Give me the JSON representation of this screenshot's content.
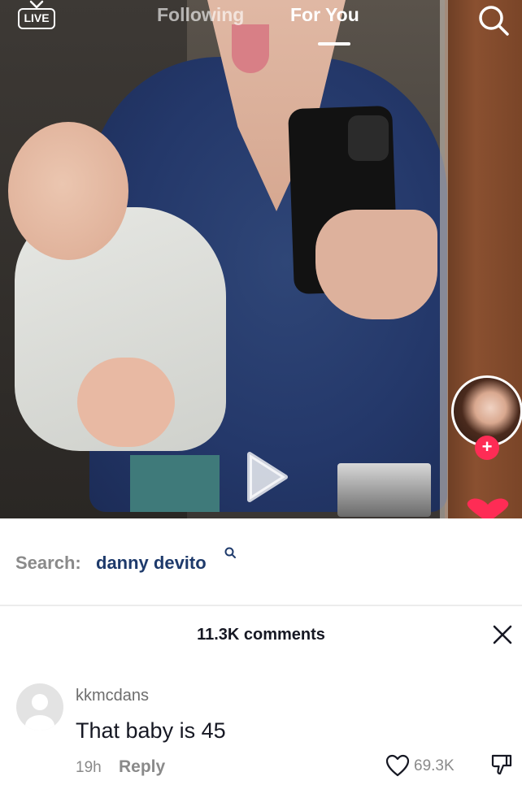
{
  "top_nav": {
    "live_label": "LIVE",
    "tab_following": "Following",
    "tab_for_you": "For You",
    "icons": [
      "live-icon",
      "search-icon"
    ]
  },
  "video": {
    "playing": false,
    "icons": [
      "play-icon",
      "plus-icon"
    ]
  },
  "search_suggestion": {
    "prefix": "Search:",
    "term": "danny devito",
    "icon": "search-icon"
  },
  "comments": {
    "count_label": "11.3K comments",
    "close_icon": "close-icon",
    "items": [
      {
        "username": "kkmcdans",
        "text": "That baby is 45",
        "time": "19h",
        "reply_label": "Reply",
        "likes": "69.3K"
      }
    ]
  },
  "colors": {
    "accent": "#fe2c55",
    "search_term": "#1e3a6b",
    "secondary_text": "#8a8a8a"
  }
}
